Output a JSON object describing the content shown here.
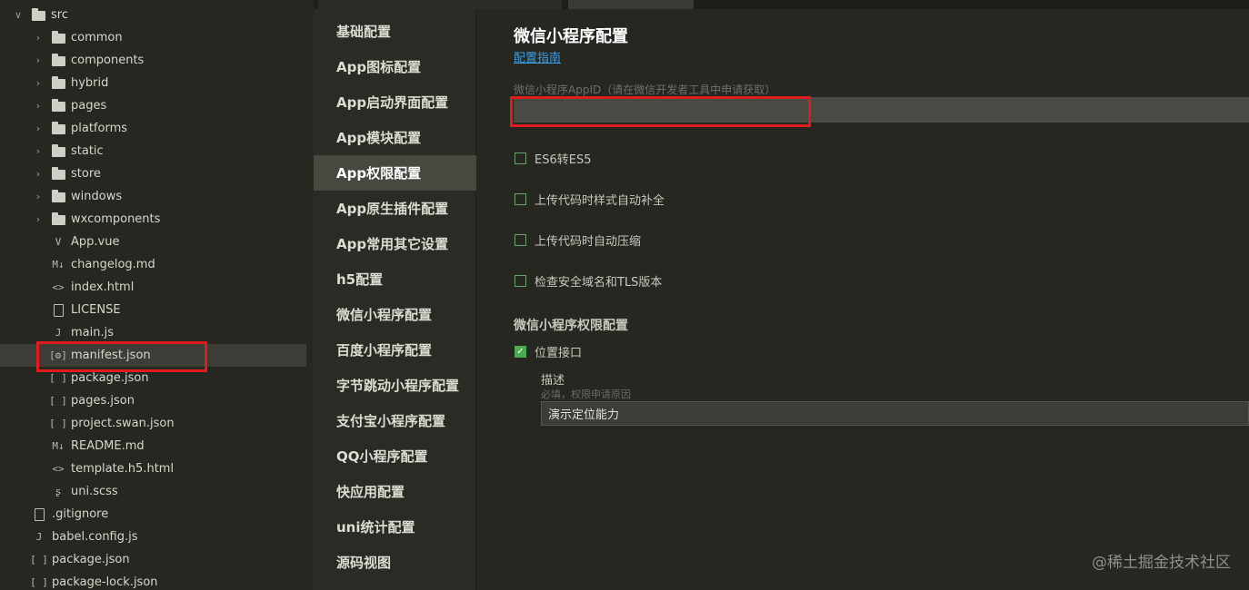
{
  "file_tree": {
    "root": {
      "label": "src",
      "expanded": true
    },
    "folders": [
      "common",
      "components",
      "hybrid",
      "pages",
      "platforms",
      "static",
      "store",
      "windows",
      "wxcomponents"
    ],
    "files": [
      {
        "label": "App.vue",
        "icon": "vue-file-icon",
        "glyph": "V"
      },
      {
        "label": "changelog.md",
        "icon": "markdown-icon",
        "glyph": "M↓"
      },
      {
        "label": "index.html",
        "icon": "html-icon",
        "glyph": "<>"
      },
      {
        "label": "LICENSE",
        "icon": "file-icon",
        "glyph": ""
      },
      {
        "label": "main.js",
        "icon": "js-file-icon",
        "glyph": "J"
      },
      {
        "label": "manifest.json",
        "icon": "json-settings-icon",
        "glyph": "[⚙]"
      },
      {
        "label": "package.json",
        "icon": "json-icon",
        "glyph": "[ ]"
      },
      {
        "label": "pages.json",
        "icon": "json-icon",
        "glyph": "[ ]"
      },
      {
        "label": "project.swan.json",
        "icon": "json-icon",
        "glyph": "[ ]"
      },
      {
        "label": "README.md",
        "icon": "markdown-icon",
        "glyph": "M↓"
      },
      {
        "label": "template.h5.html",
        "icon": "html-icon",
        "glyph": "<>"
      },
      {
        "label": "uni.scss",
        "icon": "sass-icon",
        "glyph": "ʂ"
      }
    ],
    "root_files": [
      {
        "label": ".gitignore",
        "icon": "file-icon",
        "glyph": ""
      },
      {
        "label": "babel.config.js",
        "icon": "js-file-icon",
        "glyph": "J"
      },
      {
        "label": "package.json",
        "icon": "json-icon",
        "glyph": "[ ]"
      },
      {
        "label": "package-lock.json",
        "icon": "json-icon",
        "glyph": "[ ]"
      }
    ],
    "selected": "manifest.json"
  },
  "nav": {
    "items": [
      "基础配置",
      "App图标配置",
      "App启动界面配置",
      "App模块配置",
      "App权限配置",
      "App原生插件配置",
      "App常用其它设置",
      "h5配置",
      "微信小程序配置",
      "百度小程序配置",
      "字节跳动小程序配置",
      "支付宝小程序配置",
      "QQ小程序配置",
      "快应用配置",
      "uni统计配置",
      "源码视图"
    ],
    "active_index": 4
  },
  "content": {
    "title": "微信小程序配置",
    "guide_link": "配置指南",
    "appid_label": "微信小程序AppID（请在微信开发者工具中申请获取）",
    "appid_value": "",
    "options": [
      {
        "label": "ES6转ES5",
        "checked": false
      },
      {
        "label": "上传代码时样式自动补全",
        "checked": false
      },
      {
        "label": "上传代码时自动压缩",
        "checked": false
      },
      {
        "label": "检查安全域名和TLS版本",
        "checked": false
      }
    ],
    "permission_section": "微信小程序权限配置",
    "location": {
      "label": "位置接口",
      "checked": true
    },
    "desc_label": "描述",
    "desc_hint": "必填，权限申请原因",
    "desc_value": "演示定位能力"
  },
  "watermark": "@稀土掘金技术社区",
  "colors": {
    "accent_link": "#3e9ee6",
    "highlight_border": "#e01b1b",
    "check_green": "#4caa52"
  }
}
